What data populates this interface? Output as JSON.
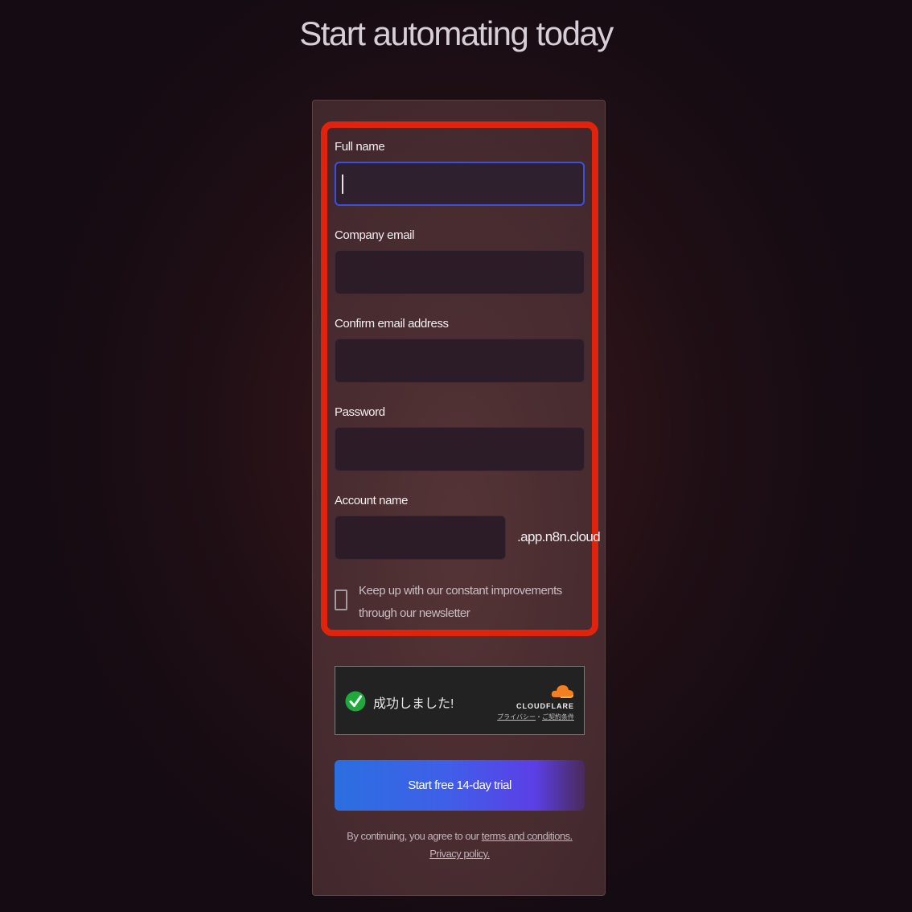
{
  "page": {
    "title": "Start automating today"
  },
  "form": {
    "full_name": {
      "label": "Full name",
      "value": ""
    },
    "company_email": {
      "label": "Company email",
      "value": ""
    },
    "confirm_email": {
      "label": "Confirm email address",
      "value": ""
    },
    "password": {
      "label": "Password",
      "value": ""
    },
    "account_name": {
      "label": "Account name",
      "value": "",
      "suffix": ".app.n8n.cloud"
    },
    "newsletter": {
      "label": "Keep up with our constant improvements through our newsletter",
      "checked": false
    }
  },
  "captcha": {
    "status_text": "成功しました!",
    "brand": "CLOUDFLARE",
    "privacy_link": "プライバシー",
    "separator": "・",
    "terms_link": "ご契約条件"
  },
  "cta": {
    "label": "Start free 14-day trial"
  },
  "legal": {
    "prefix": "By continuing, you agree to our ",
    "terms_link": "terms and conditions.",
    "privacy_link": "Privacy policy."
  },
  "colors": {
    "highlight_border": "#e0240c",
    "focus_border": "#3d4fe0",
    "cta_gradient_start": "#2b6fe0",
    "cta_gradient_end": "#5b3fe6",
    "captcha_success": "#1fa83b",
    "cloudflare_orange": "#f38020"
  }
}
